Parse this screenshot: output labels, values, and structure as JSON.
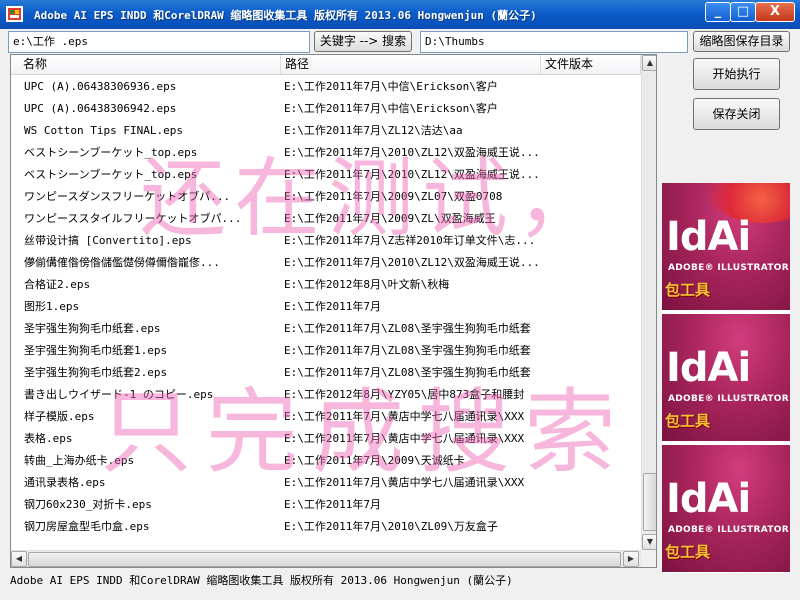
{
  "window": {
    "title": "Adobe AI EPS INDD 和CorelDRAW 缩略图收集工具  版权所有 2013.06 Hongwenjun (蘭公子)",
    "controls": {
      "minimize": "_",
      "maximize": "□",
      "close": "X"
    }
  },
  "toolbar": {
    "search_path_value": "e:\\工作 .eps",
    "keyword_search_button": "关键字 --> 搜索",
    "thumbs_dir_value": "D:\\Thumbs",
    "thumbs_dir_button": "缩略图保存目录"
  },
  "actions": {
    "start_button": "开始执行",
    "save_close_button": "保存关闭"
  },
  "table": {
    "columns": [
      "名称",
      "路径",
      "文件版本"
    ],
    "rows": [
      {
        "name": "UPC (A).06438306936.eps",
        "path": "E:\\工作2011年7月\\中信\\Erickson\\客户"
      },
      {
        "name": "UPC (A).06438306942.eps",
        "path": "E:\\工作2011年7月\\中信\\Erickson\\客户"
      },
      {
        "name": "WS Cotton Tips FINAL.eps",
        "path": "E:\\工作2011年7月\\ZL12\\洁达\\aa"
      },
      {
        "name": "ベストシーンブーケット_top.eps",
        "path": "E:\\工作2011年7月\\2010\\ZL12\\双盈海威王说..."
      },
      {
        "name": "ベストシーンブーケット_top.eps",
        "path": "E:\\工作2011年7月\\2010\\ZL12\\双盈海威王说..."
      },
      {
        "name": "ワンピースダンスフリーケットオブパ...",
        "path": "E:\\工作2011年7月\\2009\\ZL07\\双盈0708"
      },
      {
        "name": "ワンピーススタイルフリーケットオブパ...",
        "path": "E:\\工作2011年7月\\2009\\ZL\\双盈海威王"
      },
      {
        "name": "丝带设计搞 [Convertito].eps",
        "path": "E:\\工作2011年7月\\Z志祥2010年订单文件\\志..."
      },
      {
        "name": "儚偂傋傕偺傍偺儲儖儊僗僔儞偺巃俢...",
        "path": "E:\\工作2011年7月\\2010\\ZL12\\双盈海威王说..."
      },
      {
        "name": "合格证2.eps",
        "path": "E:\\工作2012年8月\\叶文新\\秋梅"
      },
      {
        "name": "图形1.eps",
        "path": "E:\\工作2011年7月"
      },
      {
        "name": "圣宇强生狗狗毛巾纸套.eps",
        "path": "E:\\工作2011年7月\\ZL08\\圣宇强生狗狗毛巾纸套"
      },
      {
        "name": "圣宇强生狗狗毛巾纸套1.eps",
        "path": "E:\\工作2011年7月\\ZL08\\圣宇强生狗狗毛巾纸套"
      },
      {
        "name": "圣宇强生狗狗毛巾纸套2.eps",
        "path": "E:\\工作2011年7月\\ZL08\\圣宇强生狗狗毛巾纸套"
      },
      {
        "name": "書き出しウイザード-1 のコピー.eps",
        "path": "E:\\工作2012年8月\\YZY05\\居中873盒子和腰封"
      },
      {
        "name": "样子模版.eps",
        "path": "E:\\工作2011年7月\\黄店中学七八届通讯录\\XXX"
      },
      {
        "name": "表格.eps",
        "path": "E:\\工作2011年7月\\黄店中学七八届通讯录\\XXX"
      },
      {
        "name": "转曲_上海办纸卡.eps",
        "path": "E:\\工作2011年7月\\2009\\天诚纸卡"
      },
      {
        "name": "通讯录表格.eps",
        "path": "E:\\工作2011年7月\\黄店中学七八届通讯录\\XXX"
      },
      {
        "name": "钢刀60x230_对折卡.eps",
        "path": "E:\\工作2011年7月"
      },
      {
        "name": "钢刀房屋盒型毛巾盒.eps",
        "path": "E:\\工作2011年7月\\2010\\ZL09\\万友盒子"
      }
    ]
  },
  "scrollbars": {
    "up": "▲",
    "down": "▼",
    "left": "◀",
    "right": "▶"
  },
  "status_text": "Adobe AI EPS INDD 和CorelDRAW 缩略图收集工具  版权所有 2013.06 Hongwenjun (蘭公子)",
  "ads": [
    {
      "brand": "IdAi",
      "sub": "ADOBE® ILLUSTRATOR",
      "badge": "包工具"
    },
    {
      "brand": "IdAi",
      "sub": "ADOBE® ILLUSTRATOR",
      "badge": "包工具"
    },
    {
      "brand": "IdAi",
      "sub": "ADOBE® ILLUSTRATOR",
      "badge": "包工具"
    }
  ],
  "watermark": {
    "line1": "还在测试，",
    "line2": "只完成搜索"
  },
  "colors": {
    "titlebar": "#0b5ccb",
    "ad_background": "#a8255c",
    "watermark": "#ee60b2"
  }
}
